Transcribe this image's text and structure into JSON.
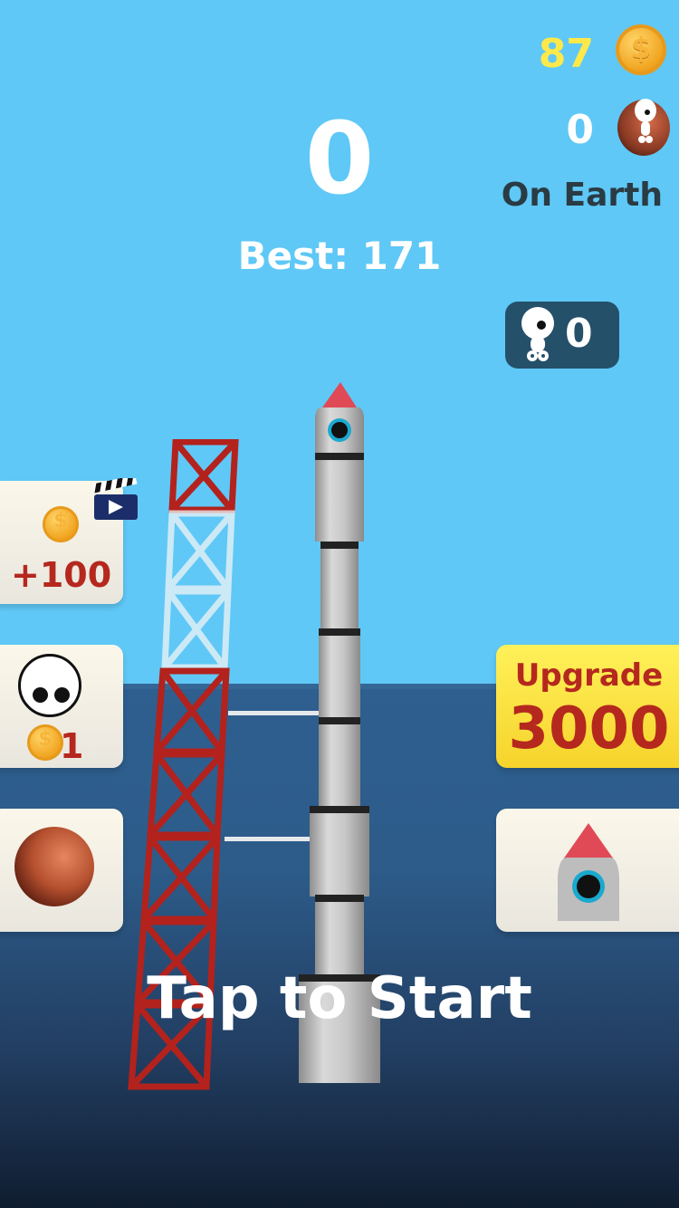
{
  "hud": {
    "score": "0",
    "best_label": "Best:",
    "best_value": "171",
    "coins": "87",
    "aliens_collected": "0",
    "location": "On Earth",
    "passengers": "0"
  },
  "buttons": {
    "free_coins": {
      "label": "+100",
      "icon": "video-clapper-icon"
    },
    "character": {
      "cost": "1"
    },
    "planet": {
      "icon": "mars-planet-icon"
    },
    "upgrade": {
      "label": "Upgrade",
      "cost": "3000"
    },
    "rocket": {
      "icon": "rocket-icon"
    }
  },
  "prompt": "Tap to Start",
  "colors": {
    "sky": "#5fc8f6",
    "sea": "#2e5f8f",
    "coin_text": "#ffe94a",
    "price_red": "#b5281e",
    "upgrade_yellow": "#f6d32b",
    "tower_red": "#b3221c"
  }
}
